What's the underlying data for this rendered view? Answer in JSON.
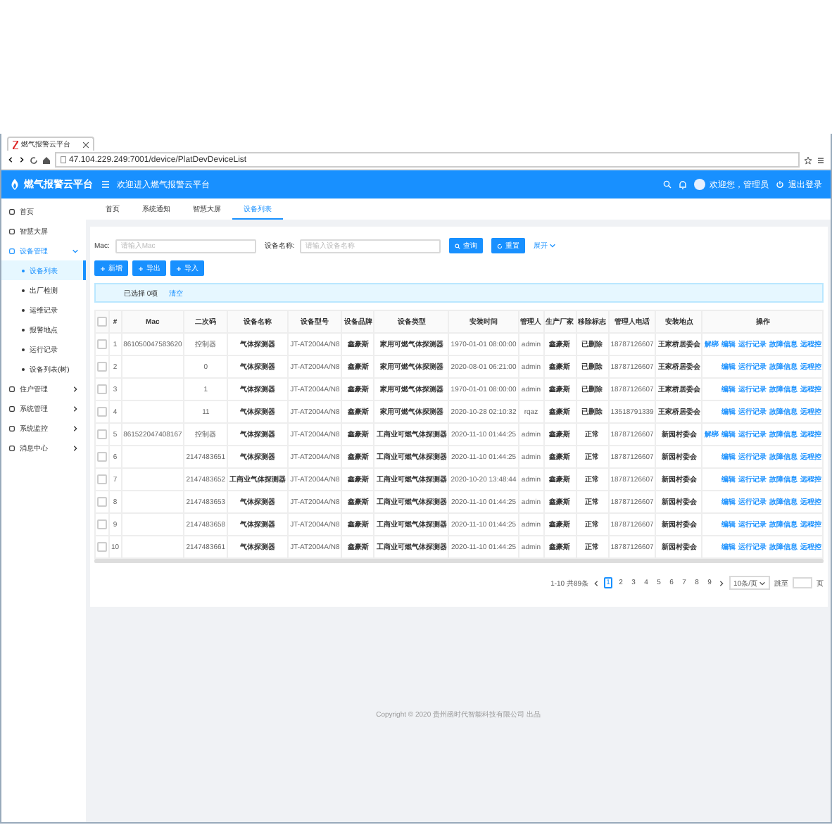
{
  "browser": {
    "tab_title": "燃气报警云平台",
    "url": "47.104.229.249:7001/device/PlatDevDeviceList"
  },
  "header": {
    "app_name": "燃气报警云平台",
    "welcome": "欢迎进入燃气报警云平台",
    "user": "欢迎您，管理员",
    "logout": "退出登录"
  },
  "sidebar": {
    "items": [
      {
        "label": "首页",
        "kind": "link",
        "selected": false
      },
      {
        "label": "智慧大屏",
        "kind": "link",
        "selected": false
      },
      {
        "label": "设备管理",
        "kind": "group",
        "selected": true,
        "expanded": true,
        "children": [
          {
            "label": "设备列表",
            "selected": true
          },
          {
            "label": "出厂检测",
            "selected": false
          },
          {
            "label": "运维记录",
            "selected": false
          },
          {
            "label": "报警地点",
            "selected": false
          },
          {
            "label": "运行记录",
            "selected": false
          },
          {
            "label": "设备列表(树)",
            "selected": false
          }
        ]
      },
      {
        "label": "住户管理",
        "kind": "group",
        "selected": false,
        "expanded": false
      },
      {
        "label": "系统管理",
        "kind": "group",
        "selected": false,
        "expanded": false
      },
      {
        "label": "系统监控",
        "kind": "group",
        "selected": false,
        "expanded": false
      },
      {
        "label": "消息中心",
        "kind": "group",
        "selected": false,
        "expanded": false
      }
    ]
  },
  "tabs": [
    {
      "label": "首页",
      "selected": false
    },
    {
      "label": "系统通知",
      "selected": false
    },
    {
      "label": "智慧大屏",
      "selected": false
    },
    {
      "label": "设备列表",
      "selected": true
    }
  ],
  "filters": [
    {
      "label": "Mac:",
      "placeholder": "请输入Mac"
    },
    {
      "label": "设备名称:",
      "placeholder": "请输入设备名称"
    }
  ],
  "search_button": "查询",
  "reset_button": "重置",
  "expand_link": "展开",
  "toolbar": [
    "新增",
    "导出",
    "导入"
  ],
  "selection": {
    "text": "已选择 0项",
    "clear": "清空"
  },
  "table": {
    "header_checked": false,
    "columns": [
      "#",
      "Mac",
      "二次码",
      "设备名称",
      "设备型号",
      "设备品牌",
      "设备类型",
      "安装时间",
      "管理人",
      "生产厂家",
      "移除标志",
      "管理人电话",
      "安装地点",
      "操作"
    ],
    "rows": [
      {
        "checked": false,
        "cells": [
          "1",
          "861050047583620",
          "控制器",
          "气体探测器",
          "JT-AT2004A/N8",
          "鑫豪斯",
          "家用可燃气体探测器",
          "1970-01-01 08:00:00",
          "admin",
          "鑫豪斯",
          "已删除",
          "18787126607",
          "王家桥居委会"
        ],
        "actions": [
          "解绑",
          "编辑",
          "运行记录",
          "故障信息",
          "远程控"
        ]
      },
      {
        "checked": false,
        "cells": [
          "2",
          "",
          "0",
          "气体探测器",
          "JT-AT2004A/N8",
          "鑫豪斯",
          "家用可燃气体探测器",
          "2020-08-01 06:21:00",
          "admin",
          "鑫豪斯",
          "已删除",
          "18787126607",
          "王家桥居委会"
        ],
        "actions": [
          "编辑",
          "运行记录",
          "故障信息",
          "远程控"
        ]
      },
      {
        "checked": false,
        "cells": [
          "3",
          "",
          "1",
          "气体探测器",
          "JT-AT2004A/N8",
          "鑫豪斯",
          "家用可燃气体探测器",
          "1970-01-01 08:00:00",
          "admin",
          "鑫豪斯",
          "已删除",
          "18787126607",
          "王家桥居委会"
        ],
        "actions": [
          "编辑",
          "运行记录",
          "故障信息",
          "远程控"
        ]
      },
      {
        "checked": false,
        "cells": [
          "4",
          "",
          "11",
          "气体探测器",
          "JT-AT2004A/N8",
          "鑫豪斯",
          "家用可燃气体探测器",
          "2020-10-28 02:10:32",
          "rqaz",
          "鑫豪斯",
          "已删除",
          "13518791339",
          "王家桥居委会"
        ],
        "actions": [
          "编辑",
          "运行记录",
          "故障信息",
          "远程控"
        ]
      },
      {
        "checked": false,
        "cells": [
          "5",
          "861522047408167",
          "控制器",
          "气体探测器",
          "JT-AT2004A/N8",
          "鑫豪斯",
          "工商业可燃气体探测器",
          "2020-11-10 01:44:25",
          "admin",
          "鑫豪斯",
          "正常",
          "18787126607",
          "新园村委会"
        ],
        "actions": [
          "解绑",
          "编辑",
          "运行记录",
          "故障信息",
          "远程控"
        ]
      },
      {
        "checked": false,
        "cells": [
          "6",
          "",
          "2147483651",
          "气体探测器",
          "JT-AT2004A/N8",
          "鑫豪斯",
          "工商业可燃气体探测器",
          "2020-11-10 01:44:25",
          "admin",
          "鑫豪斯",
          "正常",
          "18787126607",
          "新园村委会"
        ],
        "actions": [
          "编辑",
          "运行记录",
          "故障信息",
          "远程控"
        ]
      },
      {
        "checked": false,
        "cells": [
          "7",
          "",
          "2147483652",
          "工商业气体探测器",
          "JT-AT2004A/N8",
          "鑫豪斯",
          "工商业可燃气体探测器",
          "2020-10-20 13:48:44",
          "admin",
          "鑫豪斯",
          "正常",
          "18787126607",
          "新园村委会"
        ],
        "actions": [
          "编辑",
          "运行记录",
          "故障信息",
          "远程控"
        ]
      },
      {
        "checked": false,
        "cells": [
          "8",
          "",
          "2147483653",
          "气体探测器",
          "JT-AT2004A/N8",
          "鑫豪斯",
          "工商业可燃气体探测器",
          "2020-11-10 01:44:25",
          "admin",
          "鑫豪斯",
          "正常",
          "18787126607",
          "新园村委会"
        ],
        "actions": [
          "编辑",
          "运行记录",
          "故障信息",
          "远程控"
        ]
      },
      {
        "checked": false,
        "cells": [
          "9",
          "",
          "2147483658",
          "气体探测器",
          "JT-AT2004A/N8",
          "鑫豪斯",
          "工商业可燃气体探测器",
          "2020-11-10 01:44:25",
          "admin",
          "鑫豪斯",
          "正常",
          "18787126607",
          "新园村委会"
        ],
        "actions": [
          "编辑",
          "运行记录",
          "故障信息",
          "远程控"
        ]
      },
      {
        "checked": false,
        "cells": [
          "10",
          "",
          "2147483661",
          "气体探测器",
          "JT-AT2004A/N8",
          "鑫豪斯",
          "工商业可燃气体探测器",
          "2020-11-10 01:44:25",
          "admin",
          "鑫豪斯",
          "正常",
          "18787126607",
          "新园村委会"
        ],
        "actions": [
          "编辑",
          "运行记录",
          "故障信息",
          "远程控"
        ]
      }
    ]
  },
  "pagination": {
    "total": "1-10 共89条",
    "pages": [
      {
        "label": "1",
        "selected": true
      },
      {
        "label": "2",
        "selected": false
      },
      {
        "label": "3",
        "selected": false
      },
      {
        "label": "4",
        "selected": false
      },
      {
        "label": "5",
        "selected": false
      },
      {
        "label": "6",
        "selected": false
      },
      {
        "label": "7",
        "selected": false
      },
      {
        "label": "8",
        "selected": false
      },
      {
        "label": "9",
        "selected": false
      }
    ],
    "page_size": "10条/页",
    "jump_label": "跳至",
    "jump_suffix": "页"
  },
  "footer": "Copyright © 2020 贵州函时代智能科技有限公司 出品"
}
